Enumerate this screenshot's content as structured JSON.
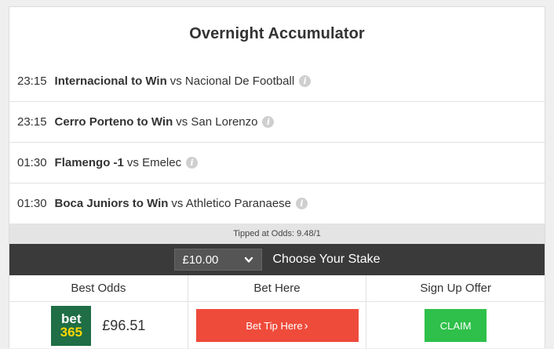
{
  "title": "Overnight Accumulator",
  "tips": [
    {
      "time": "23:15",
      "pick": "Internacional to Win",
      "vs": "vs Nacional De Football"
    },
    {
      "time": "23:15",
      "pick": "Cerro Porteno to Win",
      "vs": "vs San Lorenzo"
    },
    {
      "time": "01:30",
      "pick": "Flamengo -1",
      "vs": "vs Emelec"
    },
    {
      "time": "01:30",
      "pick": "Boca Juniors to Win",
      "vs": "vs Athletico Paranaese"
    }
  ],
  "info_glyph": "i",
  "odds_text": "Tipped at Odds: 9.48/1",
  "stake": {
    "value": "£10.00",
    "label": "Choose Your Stake"
  },
  "columns": [
    "Best Odds",
    "Bet Here",
    "Sign Up Offer"
  ],
  "offer": {
    "logo_line1": "bet",
    "logo_line2": "365",
    "returns": "£96.51",
    "bet_button": "Bet Tip Here",
    "bet_arrow": "›",
    "claim_button": "CLAIM"
  },
  "colors": {
    "bet_button": "#ee4b3b",
    "claim_button": "#2ec04a",
    "bet365_green": "#1f6e45",
    "stake_bar": "#3a3a3a"
  }
}
